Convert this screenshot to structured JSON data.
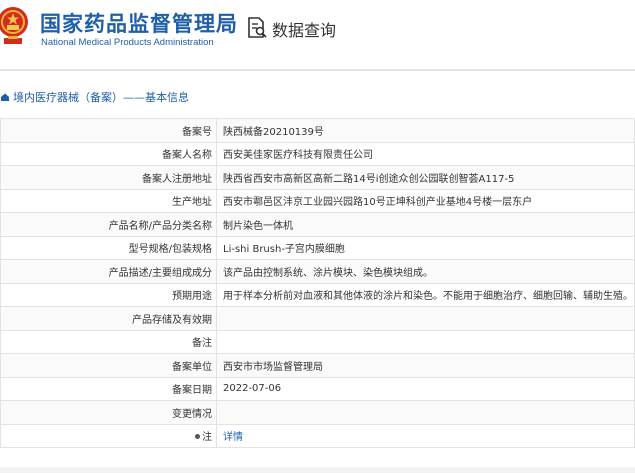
{
  "header": {
    "org_name_cn": "国家药品监督管理局",
    "org_name_en": "National Medical Products Administration",
    "query_title": "数据查询",
    "emblem_icon": "national-emblem-icon",
    "query_icon": "document-search-icon",
    "brand_color": "#1f5fa8"
  },
  "breadcrumb": {
    "text": "境内医疗器械（备案）——基本信息",
    "icon": "home-icon"
  },
  "fields": [
    {
      "label": "备案号",
      "value": "陕西械备20210139号"
    },
    {
      "label": "备案人名称",
      "value": "西安美佳家医疗科技有限责任公司"
    },
    {
      "label": "备案人注册地址",
      "value": "陕西省西安市高新区高新二路14号i创途众创公园联创智荟A117-5"
    },
    {
      "label": "生产地址",
      "value": "西安市鄠邑区沣京工业园兴园路10号正坤科创产业基地4号楼一层东户"
    },
    {
      "label": "产品名称/产品分类名称",
      "value": "制片染色一体机"
    },
    {
      "label": "型号规格/包装规格",
      "value": "Li-shi Brush-子宫内膜细胞"
    },
    {
      "label": "产品描述/主要组成成分",
      "value": "该产品由控制系统、涂片模块、染色模块组成。"
    },
    {
      "label": "预期用途",
      "value": "用于样本分析前对血液和其他体液的涂片和染色。不能用于细胞治疗、细胞回输、辅助生殖。"
    },
    {
      "label": "产品存储及有效期",
      "value": ""
    },
    {
      "label": "备注",
      "value": ""
    },
    {
      "label": "备案单位",
      "value": "西安市市场监督管理局"
    },
    {
      "label": "备案日期",
      "value": "2022-07-06"
    },
    {
      "label": "变更情况",
      "value": ""
    }
  ],
  "note_row": {
    "label": "注",
    "link": "详情",
    "icon": "bullet-icon"
  }
}
